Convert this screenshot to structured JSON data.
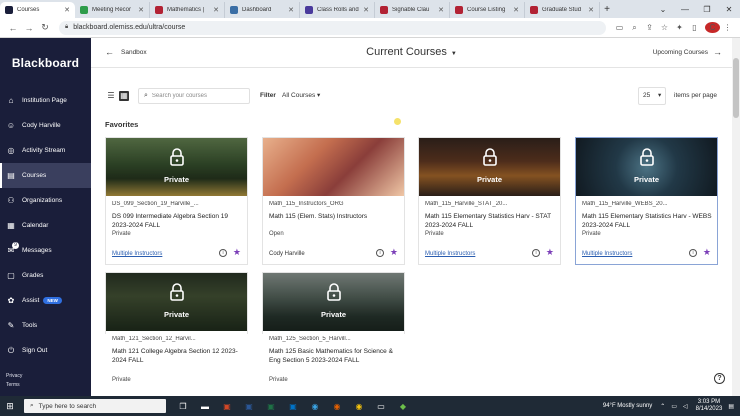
{
  "browser": {
    "tabs": [
      {
        "label": "Courses",
        "active": true,
        "color": "#1a1e3a"
      },
      {
        "label": "Meeting Recor",
        "active": false,
        "color": "#2e9c4a"
      },
      {
        "label": "Mathematics |",
        "active": false,
        "color": "#b22234"
      },
      {
        "label": "Dashboard",
        "active": false,
        "color": "#3a6ea5"
      },
      {
        "label": "Class Rolls and",
        "active": false,
        "color": "#4a3a9c"
      },
      {
        "label": "Signable Clau",
        "active": false,
        "color": "#b22234"
      },
      {
        "label": "Course Listing",
        "active": false,
        "color": "#b22234"
      },
      {
        "label": "Graduate Stud",
        "active": false,
        "color": "#b22234"
      }
    ],
    "url": "blackboard.olemiss.edu/ultra/course",
    "profile_initial": "C"
  },
  "sidebar": {
    "logo": "Blackboard",
    "items": [
      {
        "label": "Institution Page",
        "icon": "institution-icon",
        "glyph": "⌂",
        "active": false
      },
      {
        "label": "Cody Harville",
        "icon": "user-icon",
        "glyph": "☺",
        "active": false
      },
      {
        "label": "Activity Stream",
        "icon": "activity-icon",
        "glyph": "◎",
        "active": false
      },
      {
        "label": "Courses",
        "icon": "courses-icon",
        "glyph": "▤",
        "active": true
      },
      {
        "label": "Organizations",
        "icon": "organizations-icon",
        "glyph": "⚇",
        "active": false
      },
      {
        "label": "Calendar",
        "icon": "calendar-icon",
        "glyph": "▦",
        "active": false
      },
      {
        "label": "Messages",
        "icon": "messages-icon",
        "glyph": "✉",
        "active": false,
        "badge": "9"
      },
      {
        "label": "Grades",
        "icon": "grades-icon",
        "glyph": "▢",
        "active": false
      },
      {
        "label": "Assist",
        "icon": "assist-icon",
        "glyph": "✿",
        "active": false,
        "pill": "NEW"
      },
      {
        "label": "Tools",
        "icon": "tools-icon",
        "glyph": "✎",
        "active": false
      },
      {
        "label": "Sign Out",
        "icon": "sign-out-icon",
        "glyph": "⏻",
        "active": false
      }
    ],
    "footer": {
      "privacy": "Privacy",
      "terms": "Terms"
    }
  },
  "header": {
    "back_label": "Sandbox",
    "title": "Current Courses",
    "upcoming_label": "Upcoming Courses"
  },
  "filters": {
    "search_placeholder": "Search your courses",
    "filter_label": "Filter",
    "filter_value": "All Courses",
    "per_page_value": "25",
    "per_page_label": "items per page"
  },
  "favorites_heading": "Favorites",
  "courses": [
    {
      "id": "DS_099_Section_19_Harville_...",
      "name": "DS 099 Intermediate Algebra Section 19 2023-2024 FALL",
      "status": "Private",
      "instructor": "Multiple Instructors",
      "instructor_link": true,
      "private": true,
      "gradient": "linear-gradient(180deg,#6f8f5a 0%,#3d5a33 45%,#2a3b22 70%,#c9a84a 100%)"
    },
    {
      "id": "Math_115_Instructors_ORG",
      "name": "Math 115 (Elem. Stats) Instructors",
      "status": "Open",
      "instructor": "Cody Harville",
      "instructor_link": false,
      "private": false,
      "gradient": "linear-gradient(135deg,#e8b08c 0%,#c46e4f 35%,#8a3e3a 60%,#f0c7a6 100%)"
    },
    {
      "id": "Math_115_Harville_STAT_20...",
      "name": "Math 115 Elementary Statistics Harv - STAT 2023-2024 FALL",
      "status": "Private",
      "instructor": "Multiple Instructors",
      "instructor_link": true,
      "private": true,
      "gradient": "linear-gradient(180deg,#3b2a22 0%,#6b3e26 40%,#b8722f 65%,#3a2a22 100%)"
    },
    {
      "id": "Math_115_Harville_WEBS_20...",
      "name": "Math 115 Elementary Statistics Harv - WEBS 2023-2024 FALL",
      "status": "Private",
      "instructor": "Multiple Instructors",
      "instructor_link": true,
      "private": true,
      "gradient": "radial-gradient(circle at 50% 50%,#6aa0b8 0%,#2f4f63 40%,#18242e 100%)"
    },
    {
      "id": "Math_121_Section_12_Harvil...",
      "name": "Math 121 College Algebra Section 12 2023-2024 FALL",
      "status": "Private",
      "private": true,
      "gradient": "linear-gradient(180deg,#2e3a2a 0%,#4a5a3a 40%,#22301f 100%)"
    },
    {
      "id": "Math_125_Section_5_Harvill...",
      "name": "Math 125 Basic Mathematics for Science & Eng Section 5 2023-2024 FALL",
      "status": "Private",
      "private": true,
      "gradient": "linear-gradient(180deg,#9aa6a0 0%,#5f6f66 40%,#2b3a32 75%,#1e2a24 100%)"
    }
  ],
  "help_label": "?",
  "taskbar": {
    "search_placeholder": "Type here to search",
    "weather": "94°F  Mostly sunny",
    "time": "3:03 PM",
    "date": "8/14/2023"
  }
}
